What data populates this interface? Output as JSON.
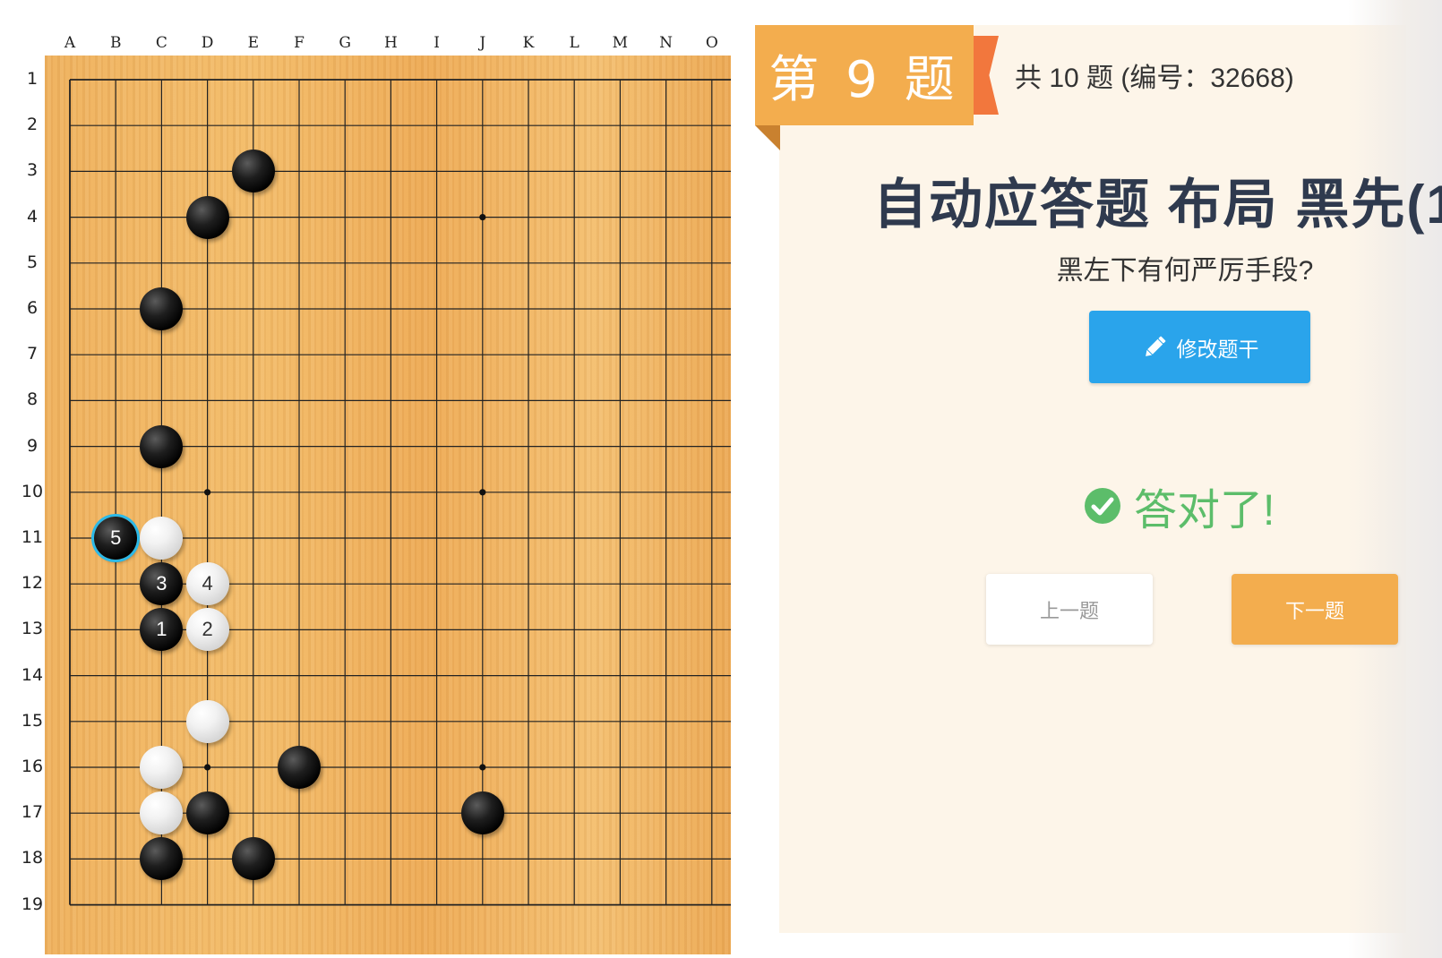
{
  "board": {
    "columns": [
      "A",
      "B",
      "C",
      "D",
      "E",
      "F",
      "G",
      "H",
      "I",
      "J",
      "K",
      "L",
      "M",
      "N",
      "O"
    ],
    "rows": [
      "1",
      "2",
      "3",
      "4",
      "5",
      "6",
      "7",
      "8",
      "9",
      "10",
      "11",
      "12",
      "13",
      "14",
      "15",
      "16",
      "17",
      "18",
      "19"
    ],
    "star_points": [
      "J4",
      "D10",
      "J10",
      "D16",
      "J16"
    ],
    "stones": [
      {
        "pos": "E3",
        "color": "black",
        "label": ""
      },
      {
        "pos": "D4",
        "color": "black",
        "label": ""
      },
      {
        "pos": "C6",
        "color": "black",
        "label": ""
      },
      {
        "pos": "C9",
        "color": "black",
        "label": ""
      },
      {
        "pos": "B11",
        "color": "black",
        "label": "5",
        "last_move": true
      },
      {
        "pos": "C11",
        "color": "white",
        "label": ""
      },
      {
        "pos": "C12",
        "color": "black",
        "label": "3"
      },
      {
        "pos": "D12",
        "color": "white",
        "label": "4"
      },
      {
        "pos": "C13",
        "color": "black",
        "label": "1"
      },
      {
        "pos": "D13",
        "color": "white",
        "label": "2"
      },
      {
        "pos": "D15",
        "color": "white",
        "label": ""
      },
      {
        "pos": "C16",
        "color": "white",
        "label": ""
      },
      {
        "pos": "F16",
        "color": "black",
        "label": ""
      },
      {
        "pos": "C17",
        "color": "white",
        "label": ""
      },
      {
        "pos": "D17",
        "color": "black",
        "label": ""
      },
      {
        "pos": "J17",
        "color": "black",
        "label": ""
      },
      {
        "pos": "C18",
        "color": "black",
        "label": ""
      },
      {
        "pos": "E18",
        "color": "black",
        "label": ""
      }
    ]
  },
  "panel": {
    "ribbon_label": "第 9 题",
    "info": "共 10 题 (编号：32668)",
    "title": "自动应答题 布局 黑先(1",
    "question": "黑左下有何严厉手段?",
    "edit_button_label": "修改题干",
    "result_text": "答对了!",
    "prev_button_label": "上一题",
    "next_button_label": "下一题"
  },
  "colors": {
    "board_wood": "#f0b35f",
    "ribbon": "#f3ad4e",
    "ribbon_tail": "#f2773d",
    "edit_button": "#2aa4eb",
    "success": "#5cbd6a",
    "next_button": "#f3ad4e",
    "last_move_ring": "#2bb9e8"
  },
  "icons": {
    "edit_button_icon": "pencil-icon",
    "result_icon": "check-circle-icon"
  }
}
